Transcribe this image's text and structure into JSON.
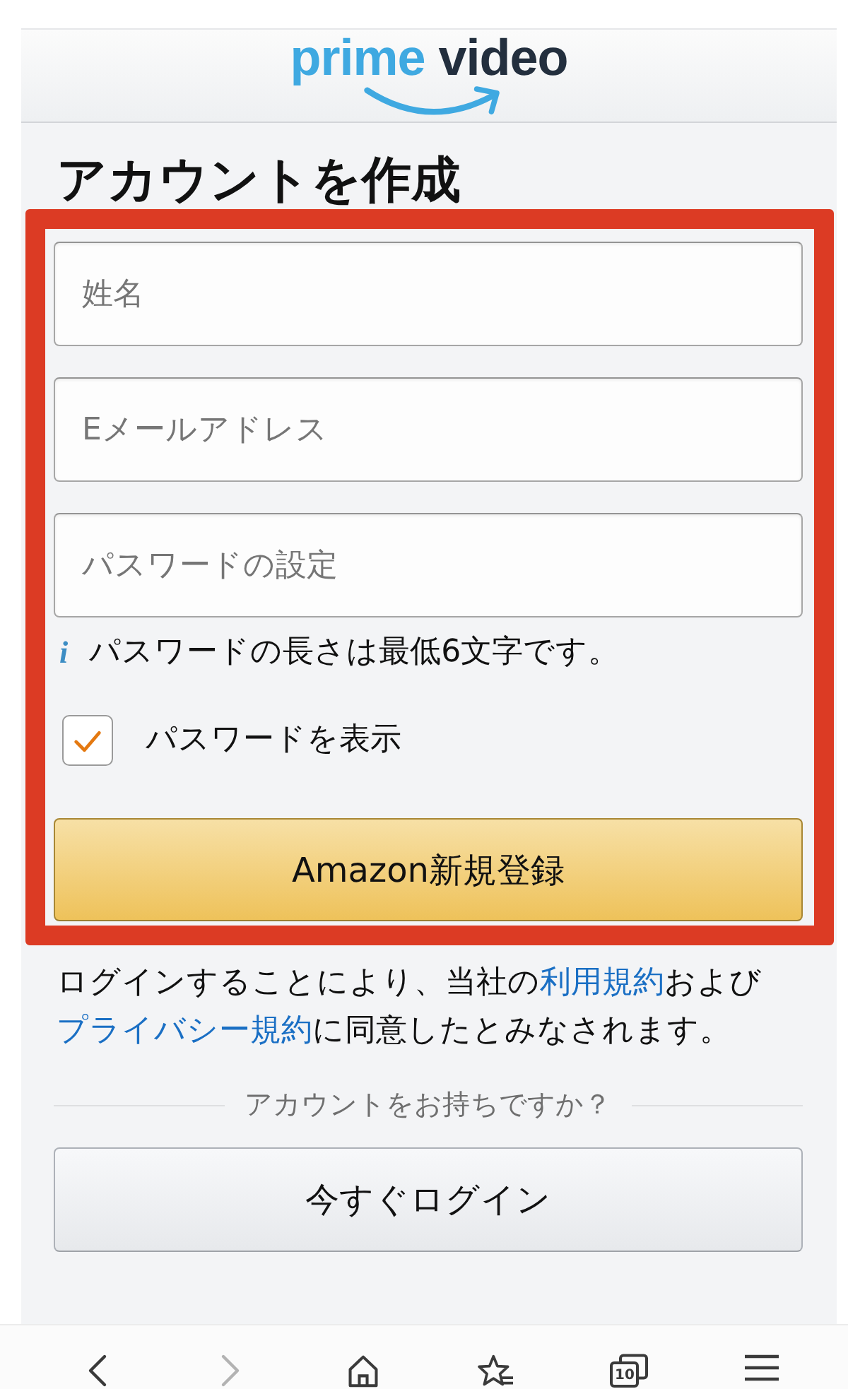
{
  "header": {
    "logo": {
      "words": [
        "prime",
        "video"
      ]
    }
  },
  "title": "アカウントを作成",
  "form": {
    "highlighted": true,
    "fields": [
      {
        "placeholder": "姓名"
      },
      {
        "placeholder": "Eメールアドレス"
      },
      {
        "placeholder": "パスワードの設定"
      }
    ],
    "hint": {
      "icon": "i",
      "text": "パスワードの長さは最低6文字です。"
    },
    "show_password": {
      "label": "パスワードを表示",
      "checked": true
    },
    "submit": "Amazon新規登録"
  },
  "agreement": [
    {
      "kind": "text",
      "text": "ログインすることにより、当社の"
    },
    {
      "kind": "link",
      "text": "利用規約"
    },
    {
      "kind": "text",
      "text": "および"
    },
    {
      "kind": "link",
      "text": "プライバシー規約"
    },
    {
      "kind": "text",
      "text": "に同意したとみなされます。"
    }
  ],
  "account_prompt": "アカウントをお持ちですか？",
  "login_button": "今すぐログイン",
  "browser_bar": {
    "items": [
      {
        "kind": "back",
        "disabled": false
      },
      {
        "kind": "forward",
        "disabled": true
      },
      {
        "kind": "home",
        "disabled": false
      },
      {
        "kind": "bookmarks",
        "disabled": false
      },
      {
        "kind": "tabs",
        "disabled": false,
        "count": "10"
      },
      {
        "kind": "menu",
        "disabled": false
      }
    ]
  }
}
